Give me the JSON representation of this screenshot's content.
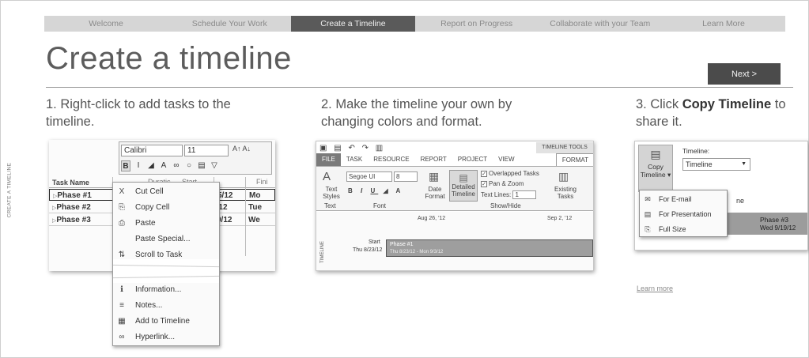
{
  "side_label": "CREATE A TIMELINE",
  "nav": {
    "items": [
      {
        "label": "Welcome"
      },
      {
        "label": "Schedule Your Work"
      },
      {
        "label": "Create a Timeline",
        "active": true
      },
      {
        "label": "Report on Progress"
      },
      {
        "label": "Collaborate with your Team"
      },
      {
        "label": "Learn More"
      }
    ]
  },
  "page_title": "Create a timeline",
  "next_label": "Next >",
  "steps": [
    {
      "prefix": "1. Right-click to add tasks to the timeline.",
      "bold": "",
      "suffix": ""
    },
    {
      "prefix": "2. Make the timeline your own by changing colors and format.",
      "bold": "",
      "suffix": ""
    },
    {
      "prefix": "3. Click ",
      "bold": "Copy Timeline",
      "suffix": " to share it."
    }
  ],
  "shot1": {
    "font_name": "Calibri",
    "font_size": "11",
    "toolbar_row2": [
      "B",
      "I",
      "◢",
      "A",
      "∞",
      "○",
      "▤",
      "▽"
    ],
    "columns": {
      "task_name": "Task Name",
      "duration": "Duratic",
      "start": "Start",
      "finish": "Fini"
    },
    "rows": [
      {
        "name": "Phase #1",
        "date": "5/12",
        "day": "Mo"
      },
      {
        "name": "Phase #2",
        "date": "'12",
        "day": "Tue"
      },
      {
        "name": "Phase #3",
        "date": "9/12",
        "day": "We"
      }
    ],
    "context_menu": [
      {
        "icon": "X",
        "label": "Cut Cell",
        "name": "ctx-cut-cell"
      },
      {
        "icon": "⎘",
        "label": "Copy Cell",
        "name": "ctx-copy-cell"
      },
      {
        "icon": "⎙",
        "label": "Paste",
        "name": "ctx-paste"
      },
      {
        "icon": "",
        "label": "Paste Special...",
        "name": "ctx-paste-special"
      },
      {
        "icon": "⇅",
        "label": "Scroll to Task",
        "name": "ctx-scroll-to-task"
      },
      {
        "icon": "ℹ",
        "label": "Information...",
        "name": "ctx-information"
      },
      {
        "icon": "≡",
        "label": "Notes...",
        "name": "ctx-notes"
      },
      {
        "icon": "▦",
        "label": "Add to Timeline",
        "name": "ctx-add-to-timeline"
      },
      {
        "icon": "∞",
        "label": "Hyperlink...",
        "name": "ctx-hyperlink"
      }
    ]
  },
  "shot2": {
    "qat": "▣ ▤ ↶ ↷ ▥",
    "tools_label": "TIMELINE TOOLS",
    "tabs": [
      "FILE",
      "TASK",
      "RESOURCE",
      "REPORT",
      "PROJECT",
      "VIEW",
      "FORMAT"
    ],
    "text_styles": "Text Styles",
    "group_text": "Text",
    "font_name": "Segoe UI",
    "font_size": "8",
    "group_font": "Font",
    "date_format": "Date Format",
    "detailed_timeline": "Detailed Timeline",
    "overlapped_tasks": "Overlapped Tasks",
    "pan_zoom": "Pan & Zoom",
    "text_lines_label": "Text Lines:",
    "text_lines_value": "1",
    "group_showhide": "Show/Hide",
    "existing_tasks": "Existing Tasks",
    "date_aug": "Aug 26, '12",
    "date_sep": "Sep 2, '12",
    "timeline_side": "TIMELINE",
    "start_label": "Start",
    "start_date": "Thu 8/23/12",
    "phase_label": "Phase #1",
    "phase_range": "Thu 8/23/12 - Mon 9/3/12"
  },
  "shot3": {
    "copy_button": "Copy Timeline",
    "timeline_label": "Timeline:",
    "timeline_value": "Timeline",
    "menu": [
      {
        "icon": "✉",
        "label": "For E-mail",
        "name": "menu-for-email"
      },
      {
        "icon": "▤",
        "label": "For Presentation",
        "name": "menu-for-presentation"
      },
      {
        "icon": "⎘",
        "label": "Full Size",
        "name": "menu-full-size"
      }
    ],
    "partial_text": "ne",
    "phase3_label": "Phase #3",
    "phase3_date": "Wed 9/19/12"
  },
  "learn_more": "Learn more"
}
